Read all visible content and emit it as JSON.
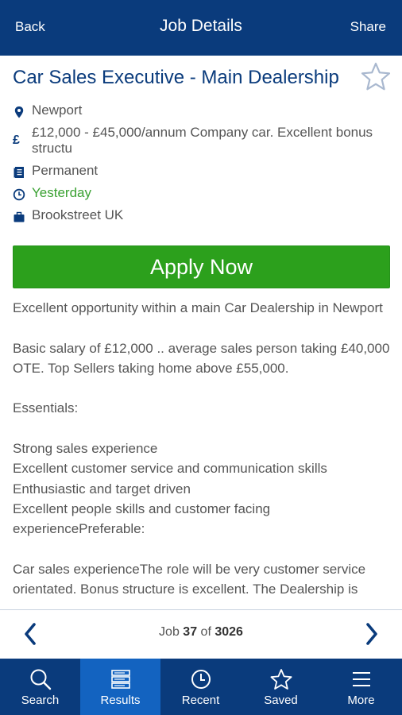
{
  "header": {
    "back_label": "Back",
    "title": "Job Details",
    "share_label": "Share"
  },
  "job": {
    "title": "Car Sales Executive - Main Dealership",
    "location": "Newport",
    "salary": "£12,000 - £45,000/annum Company car. Excellent bonus structu",
    "salary_icon": "£",
    "type": "Permanent",
    "posted": "Yesterday",
    "company": "Brookstreet UK",
    "apply_label": "Apply Now",
    "description": "Excellent opportunity within a main Car Dealership in Newport\n\nBasic salary of £12,000 .. average sales person taking £40,000 OTE. Top Sellers taking home above £55,000.\n\nEssentials:\n\nStrong sales experience\nExcellent customer service and communication skills\nEnthusiastic and target driven\nExcellent people skills and customer facing experiencePreferable:\n\nCar sales experienceThe role will be very customer service orientated. Bonus structure is excellent. The Dealership is"
  },
  "pager": {
    "prefix": "Job",
    "current": "37",
    "of": "of",
    "total": "3026"
  },
  "nav": {
    "tabs": [
      {
        "label": "Search",
        "icon": "search-icon"
      },
      {
        "label": "Results",
        "icon": "list-icon"
      },
      {
        "label": "Recent",
        "icon": "clock-icon"
      },
      {
        "label": "Saved",
        "icon": "star-icon"
      },
      {
        "label": "More",
        "icon": "menu-icon"
      }
    ],
    "active": "Results"
  },
  "colors": {
    "header_bg": "#0a3b7c",
    "title_blue": "#0a3b7c",
    "apply_green": "#2ca01c",
    "posted_green": "#3aa132",
    "active_tab": "#1363c0"
  }
}
